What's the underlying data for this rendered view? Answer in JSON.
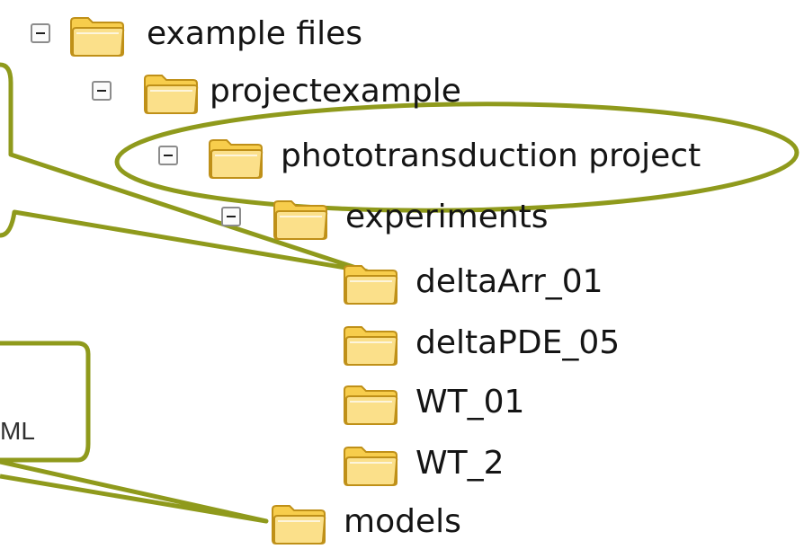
{
  "tree": {
    "items": [
      {
        "label": "example files",
        "expanded": true,
        "icon": "folder-icon"
      },
      {
        "label": "projectexample",
        "expanded": true,
        "icon": "folder-icon"
      },
      {
        "label": "phototransduction project",
        "expanded": true,
        "icon": "folder-icon"
      },
      {
        "label": "experiments",
        "expanded": true,
        "icon": "folder-icon"
      },
      {
        "label": "deltaArr_01",
        "icon": "folder-icon"
      },
      {
        "label": "deltaPDE_05",
        "icon": "folder-icon"
      },
      {
        "label": "WT_01",
        "icon": "folder-icon"
      },
      {
        "label": "WT_2",
        "icon": "folder-icon"
      },
      {
        "label": "models",
        "icon": "folder-icon"
      }
    ]
  },
  "callout": {
    "text": "ML"
  },
  "colors": {
    "annotation_stroke": "#8f9a1c",
    "folder_fill": "#f7cd4c",
    "folder_front": "#fbe08a",
    "folder_outline": "#bf9018",
    "text": "#141414"
  }
}
